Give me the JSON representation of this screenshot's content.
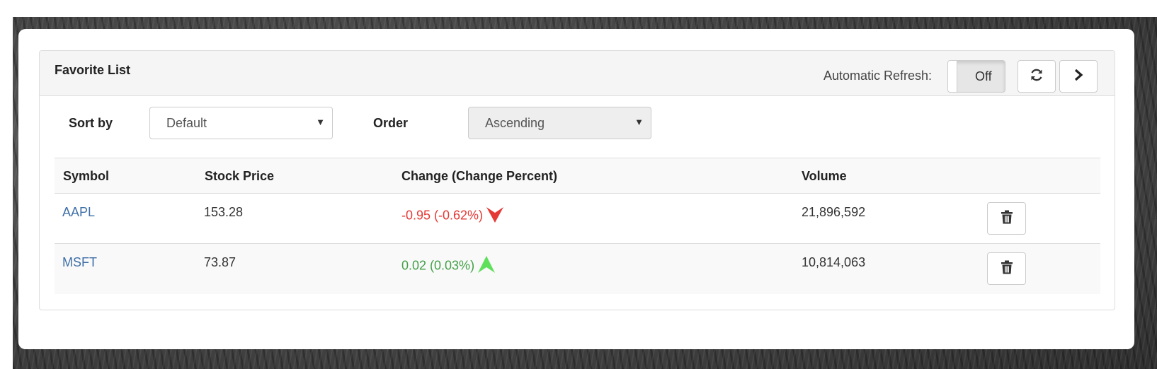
{
  "panel": {
    "title": "Favorite List",
    "auto_refresh_label": "Automatic Refresh:",
    "auto_refresh_value": "Off",
    "refresh_icon": "refresh-icon",
    "next_icon": "chevron-right-icon"
  },
  "filters": {
    "sort_label": "Sort by",
    "sort_value": "Default",
    "order_label": "Order",
    "order_value": "Ascending"
  },
  "table": {
    "headers": [
      "Symbol",
      "Stock Price",
      "Change (Change Percent)",
      "Volume"
    ],
    "rows": [
      {
        "symbol": "AAPL",
        "price": "153.28",
        "change": "-0.95 (-0.62%)",
        "direction": "down",
        "volume": "21,896,592",
        "delete_icon": "trash-icon"
      },
      {
        "symbol": "MSFT",
        "price": "73.87",
        "change": "0.02 (0.03%)",
        "direction": "up",
        "volume": "10,814,063",
        "delete_icon": "trash-icon"
      }
    ]
  },
  "colors": {
    "link": "#3f6fa8",
    "negative": "#e53935",
    "positive": "#43a047",
    "arrow_down": "#e53935",
    "arrow_up": "#5ee05a"
  }
}
